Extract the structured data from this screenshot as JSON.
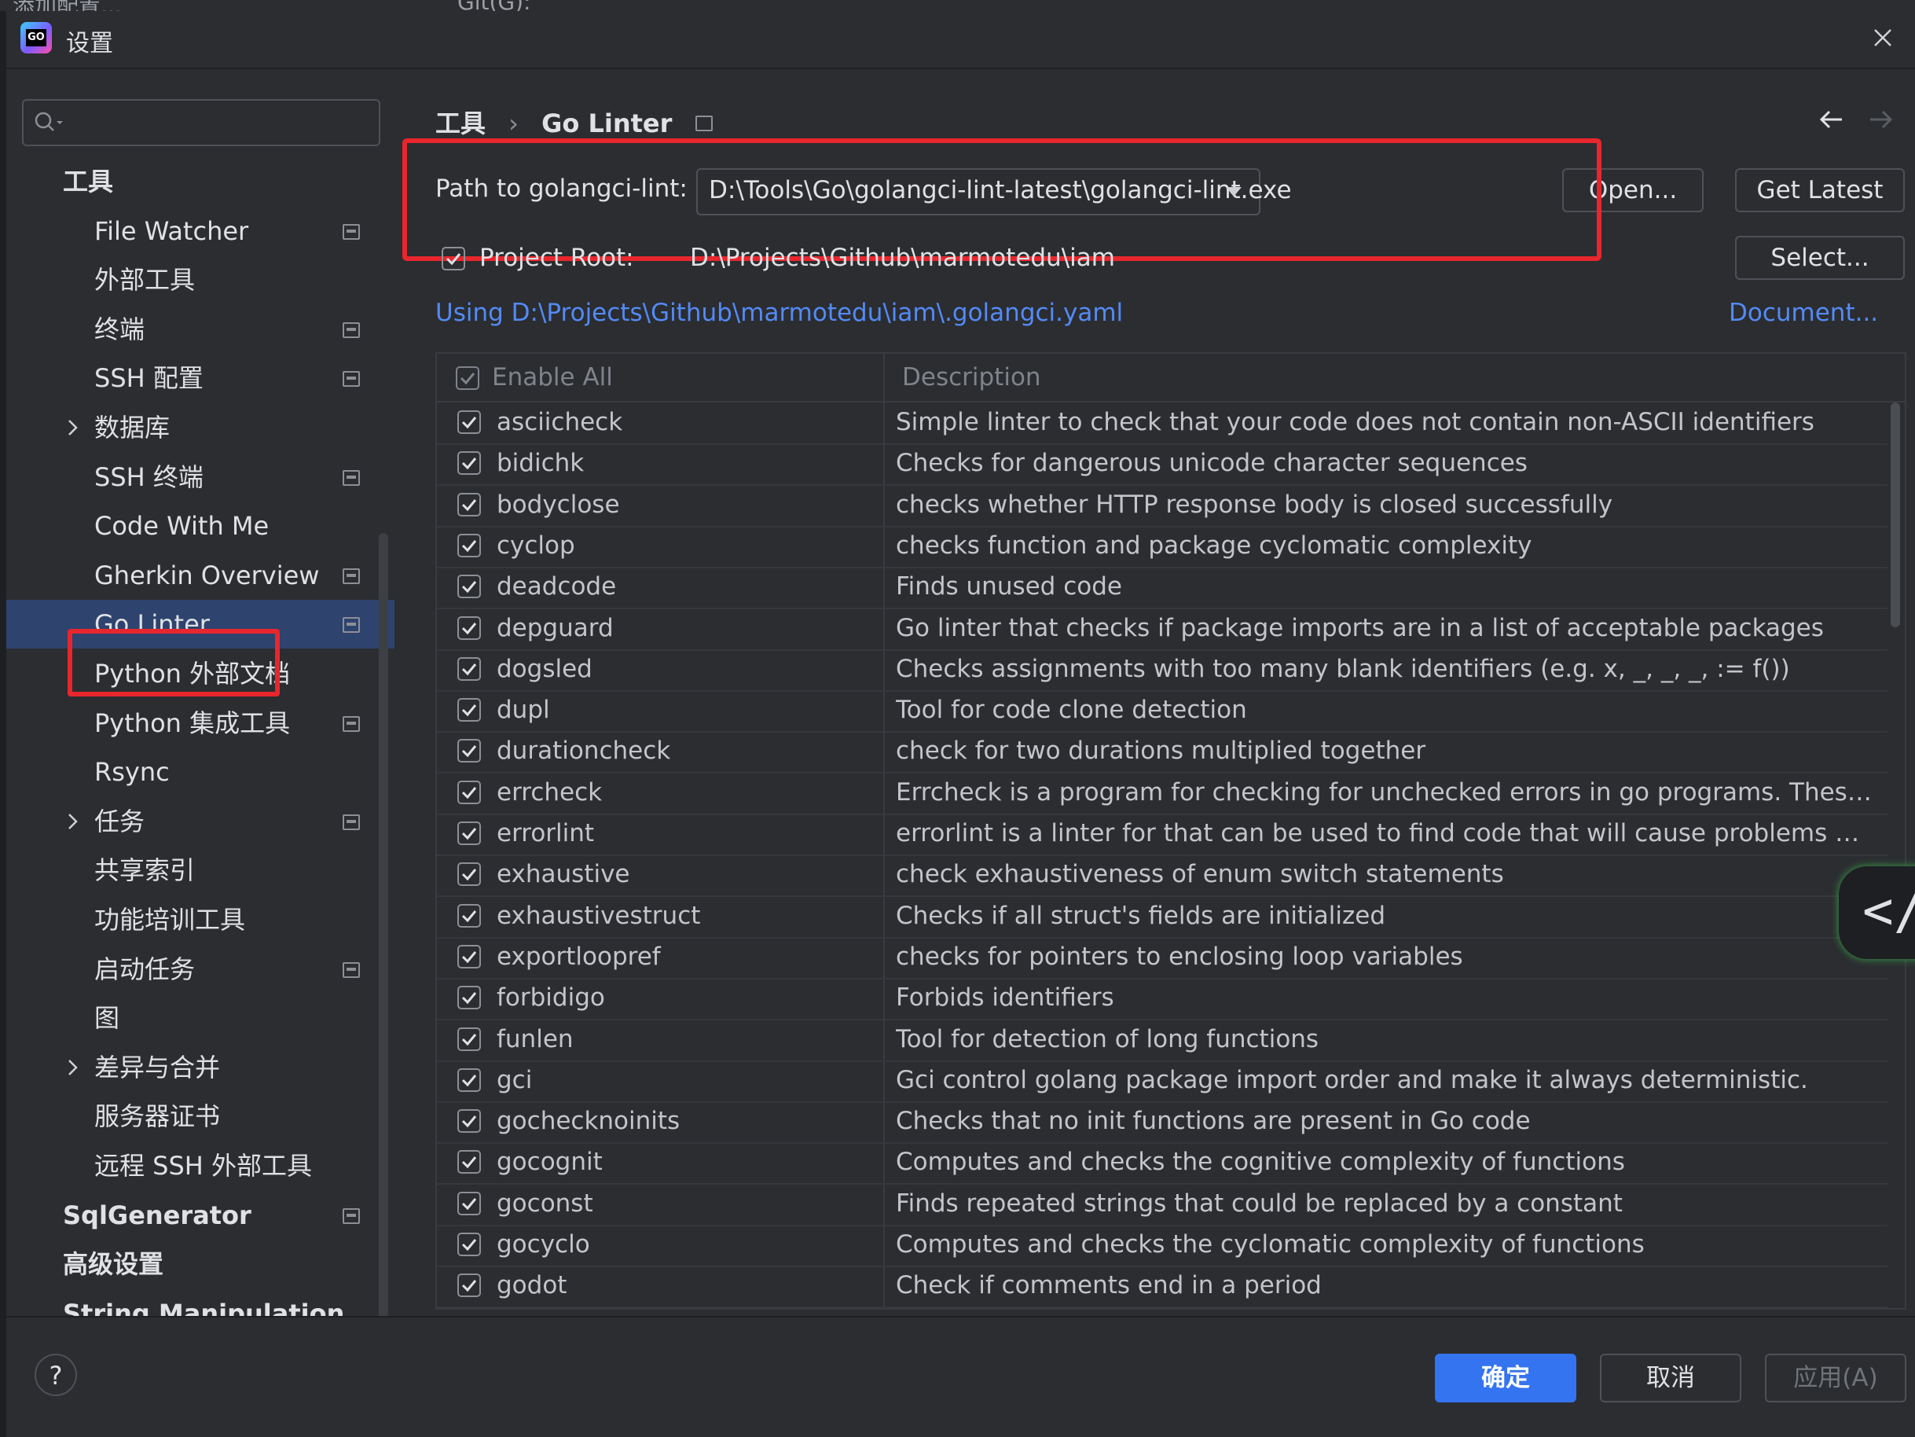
{
  "top_strip": {
    "left_text": "添加配置...",
    "git_label": "Git(G):"
  },
  "window": {
    "title": "设置",
    "logo_text": "GO"
  },
  "sidebar": {
    "search": {
      "placeholder": ""
    },
    "items": [
      {
        "label": "工具",
        "level": "top",
        "pin": false,
        "chevron": false
      },
      {
        "label": "File Watcher",
        "pin": true,
        "chevron": false
      },
      {
        "label": "外部工具",
        "pin": false,
        "chevron": false
      },
      {
        "label": "终端",
        "pin": true,
        "chevron": false
      },
      {
        "label": "SSH 配置",
        "pin": true,
        "chevron": false
      },
      {
        "label": "数据库",
        "pin": false,
        "chevron": true
      },
      {
        "label": "SSH 终端",
        "pin": true,
        "chevron": false
      },
      {
        "label": "Code With Me",
        "pin": false,
        "chevron": false
      },
      {
        "label": "Gherkin Overview",
        "pin": true,
        "chevron": false
      },
      {
        "label": "Go Linter",
        "pin": true,
        "chevron": false,
        "selected": true
      },
      {
        "label": "Python 外部文档",
        "pin": false,
        "chevron": false
      },
      {
        "label": "Python 集成工具",
        "pin": true,
        "chevron": false
      },
      {
        "label": "Rsync",
        "pin": false,
        "chevron": false
      },
      {
        "label": "任务",
        "pin": true,
        "chevron": true
      },
      {
        "label": "共享索引",
        "pin": false,
        "chevron": false
      },
      {
        "label": "功能培训工具",
        "pin": false,
        "chevron": false
      },
      {
        "label": "启动任务",
        "pin": true,
        "chevron": false
      },
      {
        "label": "图",
        "pin": false,
        "chevron": false
      },
      {
        "label": "差异与合并",
        "pin": false,
        "chevron": true
      },
      {
        "label": "服务器证书",
        "pin": false,
        "chevron": false
      },
      {
        "label": "远程 SSH 外部工具",
        "pin": false,
        "chevron": false
      },
      {
        "label": "SqlGenerator",
        "level": "top",
        "pin": true,
        "chevron": false
      },
      {
        "label": "高级设置",
        "level": "top",
        "pin": false,
        "chevron": false
      },
      {
        "label": "String Manipulation",
        "level": "top",
        "pin": false,
        "chevron": false
      }
    ]
  },
  "content": {
    "breadcrumb": {
      "parent": "工具",
      "separator": "›",
      "current": "Go Linter"
    },
    "path": {
      "label": "Path to golangci-lint:",
      "value": "D:\\Tools\\Go\\golangci-lint-latest\\golangci-lint.exe",
      "open_button": "Open...",
      "latest_button": "Get Latest"
    },
    "project_root": {
      "checked": true,
      "label": "Project Root:",
      "value": "D:\\Projects\\Github\\marmotedu\\iam",
      "select_button": "Select..."
    },
    "config_link": "Using D:\\Projects\\Github\\marmotedu\\iam\\.golangci.yaml",
    "doc_link": "Document...",
    "table": {
      "columns": [
        "Enable All",
        "Description"
      ],
      "rows": [
        {
          "name": "asciicheck",
          "description": "Simple linter to check that your code does not contain non-ASCII identifiers"
        },
        {
          "name": "bidichk",
          "description": "Checks for dangerous unicode character sequences"
        },
        {
          "name": "bodyclose",
          "description": "checks whether HTTP response body is closed successfully"
        },
        {
          "name": "cyclop",
          "description": "checks function and package cyclomatic complexity"
        },
        {
          "name": "deadcode",
          "description": "Finds unused code"
        },
        {
          "name": "depguard",
          "description": "Go linter that checks if package imports are in a list of acceptable packages"
        },
        {
          "name": "dogsled",
          "description": "Checks assignments with too many blank identifiers (e.g. x, _, _, _, := f())"
        },
        {
          "name": "dupl",
          "description": "Tool for code clone detection"
        },
        {
          "name": "durationcheck",
          "description": "check for two durations multiplied together"
        },
        {
          "name": "errcheck",
          "description": "Errcheck is a program for checking for unchecked errors in go programs. These unche..."
        },
        {
          "name": "errorlint",
          "description": "errorlint is a linter for that can be used to find code that will cause problems with the..."
        },
        {
          "name": "exhaustive",
          "description": "check exhaustiveness of enum switch statements"
        },
        {
          "name": "exhaustivestruct",
          "description": "Checks if all struct's fields are initialized"
        },
        {
          "name": "exportloopref",
          "description": "checks for pointers to enclosing loop variables"
        },
        {
          "name": "forbidigo",
          "description": "Forbids identifiers"
        },
        {
          "name": "funlen",
          "description": "Tool for detection of long functions"
        },
        {
          "name": "gci",
          "description": "Gci control golang package import order and make it always deterministic."
        },
        {
          "name": "gochecknoinits",
          "description": "Checks that no init functions are present in Go code"
        },
        {
          "name": "gocognit",
          "description": "Computes and checks the cognitive complexity of functions"
        },
        {
          "name": "goconst",
          "description": "Finds repeated strings that could be replaced by a constant"
        },
        {
          "name": "gocyclo",
          "description": "Computes and checks the cyclomatic complexity of functions"
        },
        {
          "name": "godot",
          "description": "Check if comments end in a period"
        }
      ]
    }
  },
  "floating_widget": {
    "text": "</"
  },
  "footer": {
    "help": "?",
    "ok": "确定",
    "cancel": "取消",
    "apply": "应用(A)"
  },
  "colors": {
    "accent": "#3574f0",
    "link": "#548af7",
    "highlight": "#e8262d",
    "selected": "#2e436e"
  }
}
